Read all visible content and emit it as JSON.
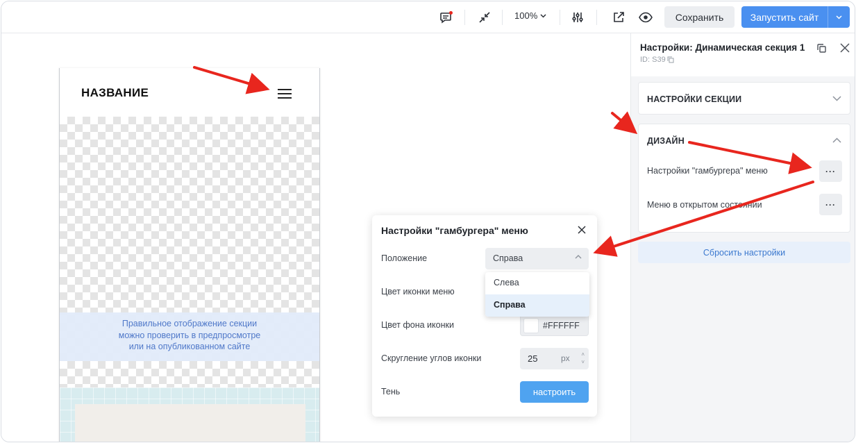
{
  "topbar": {
    "zoom": "100%",
    "save_label": "Сохранить",
    "launch_label": "Запустить сайт"
  },
  "preview": {
    "site_title": "НАЗВАНИЕ",
    "notice_line1": "Правильное отображение секции",
    "notice_line2": "можно проверить в предпросмотре",
    "notice_line3": "или на опубликованном сайте"
  },
  "popup": {
    "title": "Настройки \"гамбургера\" меню",
    "position_label": "Положение",
    "position_value": "Справа",
    "position_options": [
      "Слева",
      "Справа"
    ],
    "icon_color_label": "Цвет иконки меню",
    "icon_bg_label": "Цвет фона иконки",
    "icon_bg_value": "#FFFFFF",
    "radius_label": "Скругление углов иконки",
    "radius_value": "25",
    "radius_unit": "px",
    "shadow_label": "Тень",
    "shadow_button": "настроить"
  },
  "panel": {
    "title": "Настройки: Динамическая секция 1",
    "id_text": "ID: S39",
    "section_settings_title": "НАСТРОЙКИ СЕКЦИИ",
    "design_title": "ДИЗАЙН",
    "hamburger_settings_label": "Настройки \"гамбургера\" меню",
    "open_menu_label": "Меню в открытом состоянии",
    "dots": "···",
    "reset_label": "Сбросить настройки"
  },
  "colors": {
    "accent": "#4a90f0",
    "arrow": "#e8261e",
    "notice_text": "#4f78c9"
  }
}
